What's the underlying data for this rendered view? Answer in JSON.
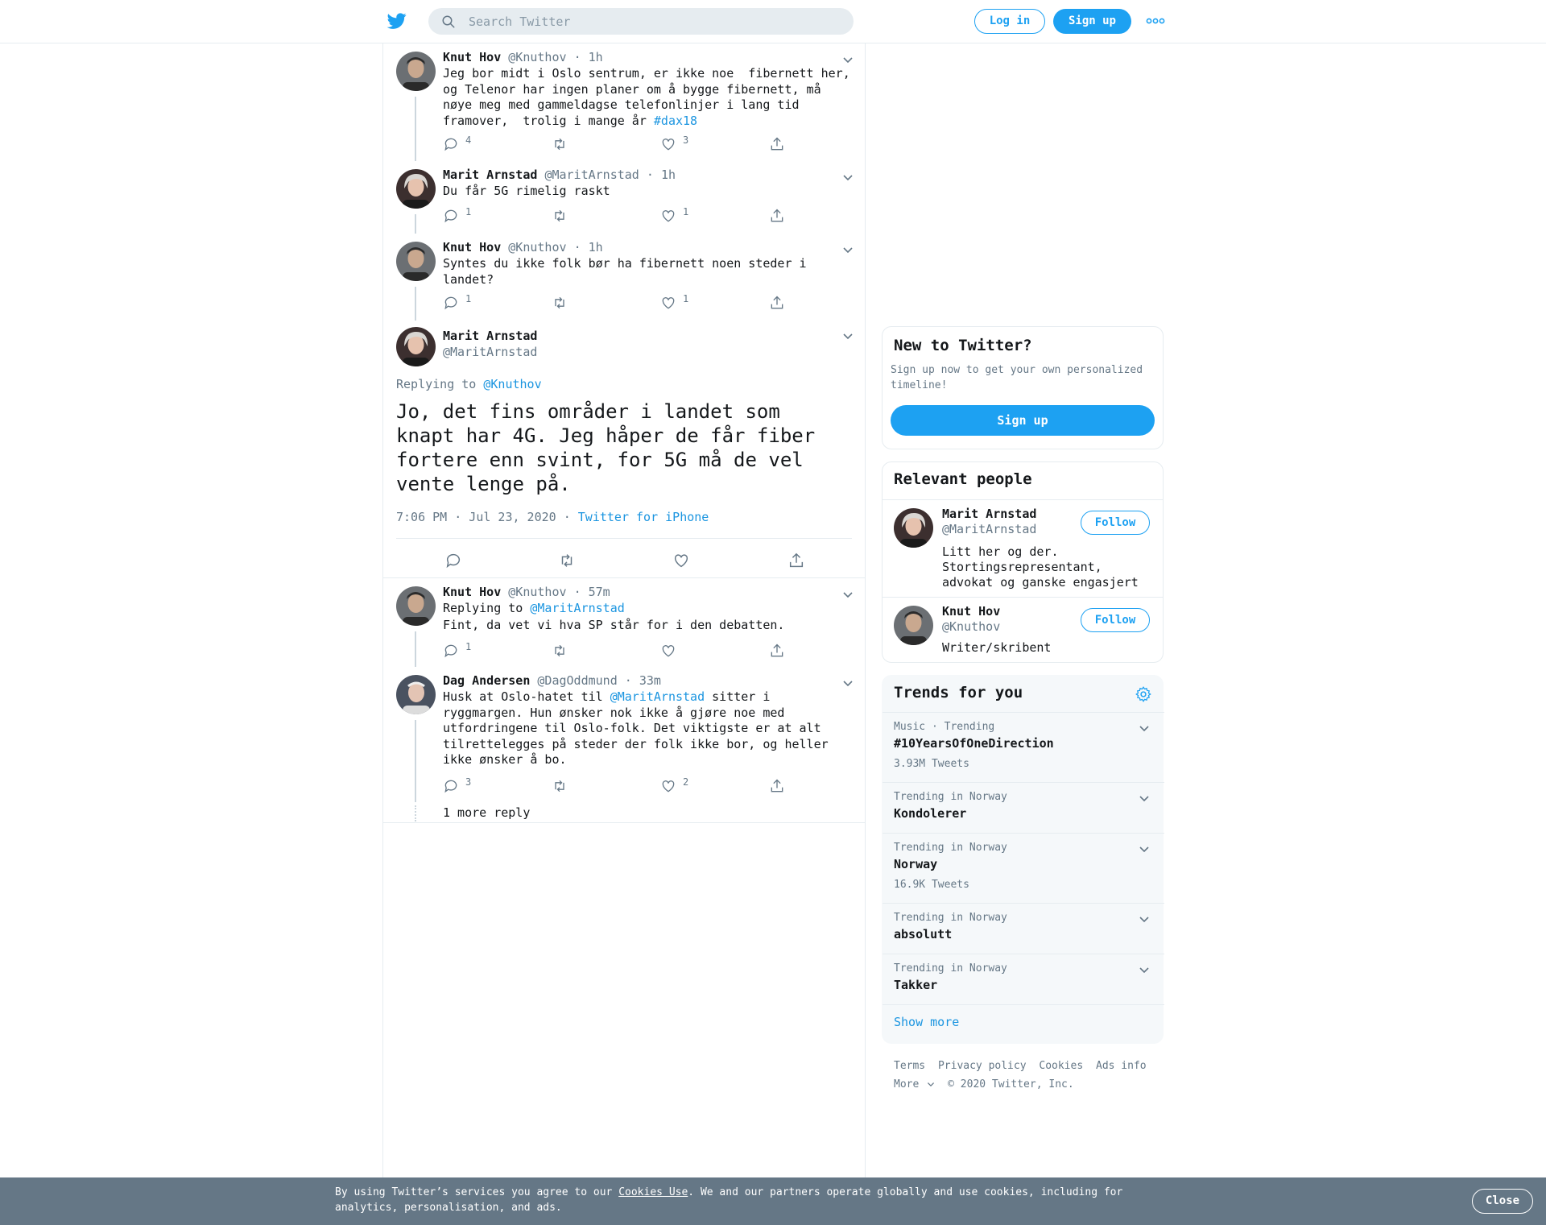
{
  "header": {
    "search_placeholder": "Search Twitter",
    "login_label": "Log in",
    "signup_label": "Sign up"
  },
  "thread": [
    {
      "name": "Knut Hov",
      "handle": "@Knuthov",
      "time": "1h",
      "text": "Jeg bor midt i Oslo sentrum, er ikke noe  fibernett her, og Telenor har ingen planer om å bygge fibernett, må nøye meg med gammeldagse telefonlinjer i lang tid framover,  trolig i mange år ",
      "hashtag": "#dax18",
      "reply_count": "4",
      "like_count": "3"
    },
    {
      "name": "Marit Arnstad",
      "handle": "@MaritArnstad",
      "time": "1h",
      "text": "Du får 5G rimelig raskt",
      "reply_count": "1",
      "like_count": "1"
    },
    {
      "name": "Knut Hov",
      "handle": "@Knuthov",
      "time": "1h",
      "text": "Syntes du ikke folk bør ha fibernett noen steder i landet?",
      "reply_count": "1",
      "like_count": "1"
    }
  ],
  "focus": {
    "name": "Marit Arnstad",
    "handle": "@MaritArnstad",
    "replying_prefix": "Replying to ",
    "replying_to": "@Knuthov",
    "text": "Jo, det fins områder i landet som knapt har 4G. Jeg håper de får fiber fortere enn svint, for 5G må de vel vente lenge på.",
    "timestamp": "7:06 PM · Jul 23, 2020",
    "source": "Twitter for iPhone"
  },
  "replies": [
    {
      "name": "Knut Hov",
      "handle": "@Knuthov",
      "time": "57m",
      "replying_prefix": "Replying to ",
      "replying_to": "@MaritArnstad",
      "text": "Fint, da vet vi hva SP står for i den debatten.",
      "reply_count": "1",
      "like_count": ""
    },
    {
      "name": "Dag Andersen",
      "handle": "@DagOddmund",
      "time": "33m",
      "text_before": "Husk at Oslo-hatet til ",
      "mention": "@MaritArnstad",
      "text_after": " sitter i ryggmargen. Hun ønsker nok ikke å gjøre noe med utfordringene til Oslo-folk. Det viktigste er at alt tilrettelegges på steder der folk ikke bor, og heller ikke ønsker å bo.",
      "reply_count": "3",
      "like_count": "2"
    }
  ],
  "more_replies_label": "1 more reply",
  "sidebar": {
    "new_title": "New to Twitter?",
    "new_desc": "Sign up now to get your own personalized timeline!",
    "new_signup": "Sign up",
    "people_title": "Relevant people",
    "people": [
      {
        "name": "Marit Arnstad",
        "handle": "@MaritArnstad",
        "bio": "Litt her og der. Stortingsrepresentant, advokat og ganske engasjert",
        "follow": "Follow"
      },
      {
        "name": "Knut Hov",
        "handle": "@Knuthov",
        "bio": "Writer/skribent",
        "follow": "Follow"
      }
    ],
    "trends_title": "Trends for you",
    "trends": [
      {
        "context": "Music · Trending",
        "name": "#10YearsOfOneDirection",
        "count": "3.93M Tweets"
      },
      {
        "context": "Trending in Norway",
        "name": "Kondolerer",
        "count": ""
      },
      {
        "context": "Trending in Norway",
        "name": "Norway",
        "count": "16.9K Tweets"
      },
      {
        "context": "Trending in Norway",
        "name": "absolutt",
        "count": ""
      },
      {
        "context": "Trending in Norway",
        "name": "Takker",
        "count": ""
      }
    ],
    "show_more": "Show more"
  },
  "footer": {
    "links": [
      "Terms",
      "Privacy policy",
      "Cookies",
      "Ads info"
    ],
    "more": "More",
    "copyright": "© 2020 Twitter, Inc."
  },
  "cookie": {
    "text_before": "By using Twitter’s services you agree to our ",
    "link": "Cookies Use",
    "text_after": ". We and our partners operate globally and use cookies, including for analytics, personalisation, and ads.",
    "close": "Close"
  },
  "colors": {
    "accent": "#1da1f2",
    "link": "#1b95e0",
    "muted": "#657786",
    "cookie_bg": "#657786"
  }
}
